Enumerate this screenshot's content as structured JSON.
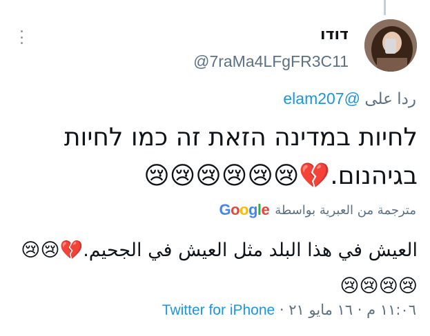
{
  "tweet": {
    "display_name": "דודו",
    "handle": "@7raMa4LFgFR3C11",
    "reply_prefix": "ردا على",
    "reply_mention": "@elam207",
    "text": "לחיות במדינה הזאת זה כמו לחיות בגיהנום.💔😢😢😢😢😢😢",
    "translation_label": "مترجمة من العبرية بواسطة",
    "translation_provider": "Google",
    "translated_text": "العيش في هذا البلد مثل العيش في الجحيم.💔😢😢😢😢😢😢",
    "timestamp": "١١:٠٦ م · ١٦ مايو ٢١",
    "separator": "·",
    "source": "Twitter for iPhone"
  },
  "icons": {
    "more": "more-icon",
    "avatar": "avatar"
  },
  "colors": {
    "link": "#1b95e0",
    "secondary": "#5b7083",
    "text": "#0f1419"
  }
}
